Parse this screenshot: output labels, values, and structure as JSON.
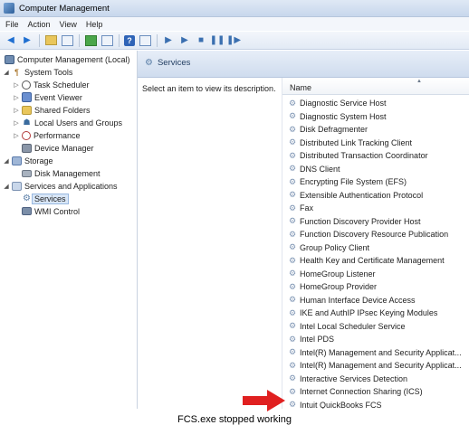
{
  "window": {
    "title": "Computer Management"
  },
  "menu": [
    "File",
    "Action",
    "View",
    "Help"
  ],
  "toolbar": [
    {
      "icon": "back-arrow-icon"
    },
    {
      "icon": "forward-arrow-icon"
    },
    {
      "icon": "up-folder-icon"
    },
    {
      "icon": "show-hide-tree-icon"
    },
    {
      "icon": "refresh-icon"
    },
    {
      "icon": "export-list-icon"
    },
    {
      "icon": "help-icon"
    },
    {
      "icon": "show-hide-action-pane-icon"
    },
    {
      "icon": "play-icon"
    },
    {
      "icon": "play-alt-icon"
    },
    {
      "icon": "stop-icon"
    },
    {
      "icon": "pause-icon"
    },
    {
      "icon": "restart-icon"
    }
  ],
  "tree": {
    "items": [
      {
        "label": "Computer Management (Local)",
        "icon": "computer-icon"
      },
      {
        "label": "System Tools",
        "icon": "tools-icon"
      },
      {
        "label": "Task Scheduler",
        "icon": "clock-icon"
      },
      {
        "label": "Event Viewer",
        "icon": "event-viewer-icon"
      },
      {
        "label": "Shared Folders",
        "icon": "shared-folder-icon"
      },
      {
        "label": "Local Users and Groups",
        "icon": "users-icon"
      },
      {
        "label": "Performance",
        "icon": "performance-icon"
      },
      {
        "label": "Device Manager",
        "icon": "device-manager-icon"
      },
      {
        "label": "Storage",
        "icon": "storage-icon"
      },
      {
        "label": "Disk Management",
        "icon": "disk-icon"
      },
      {
        "label": "Services and Applications",
        "icon": "services-apps-icon"
      },
      {
        "label": "Services",
        "icon": "gear-icon"
      },
      {
        "label": "WMI Control",
        "icon": "wmi-icon"
      }
    ]
  },
  "content": {
    "header_title": "Services",
    "description": "Select an item to view its description.",
    "column_name": "Name",
    "services": [
      "Diagnostic Service Host",
      "Diagnostic System Host",
      "Disk Defragmenter",
      "Distributed Link Tracking Client",
      "Distributed Transaction Coordinator",
      "DNS Client",
      "Encrypting File System (EFS)",
      "Extensible Authentication Protocol",
      "Fax",
      "Function Discovery Provider Host",
      "Function Discovery Resource Publication",
      "Group Policy Client",
      "Health Key and Certificate Management",
      "HomeGroup Listener",
      "HomeGroup Provider",
      "Human Interface Device Access",
      "IKE and AuthIP IPsec Keying Modules",
      "Intel Local Scheduler Service",
      "Intel PDS",
      "Intel(R) Management and Security Applicat...",
      "Intel(R) Management and Security Applicat...",
      "Interactive Services Detection",
      "Internet Connection Sharing (ICS)",
      "Intuit QuickBooks FCS"
    ]
  },
  "annotation": {
    "arrow_color": "#e02020"
  },
  "caption": "FCS.exe stopped working"
}
